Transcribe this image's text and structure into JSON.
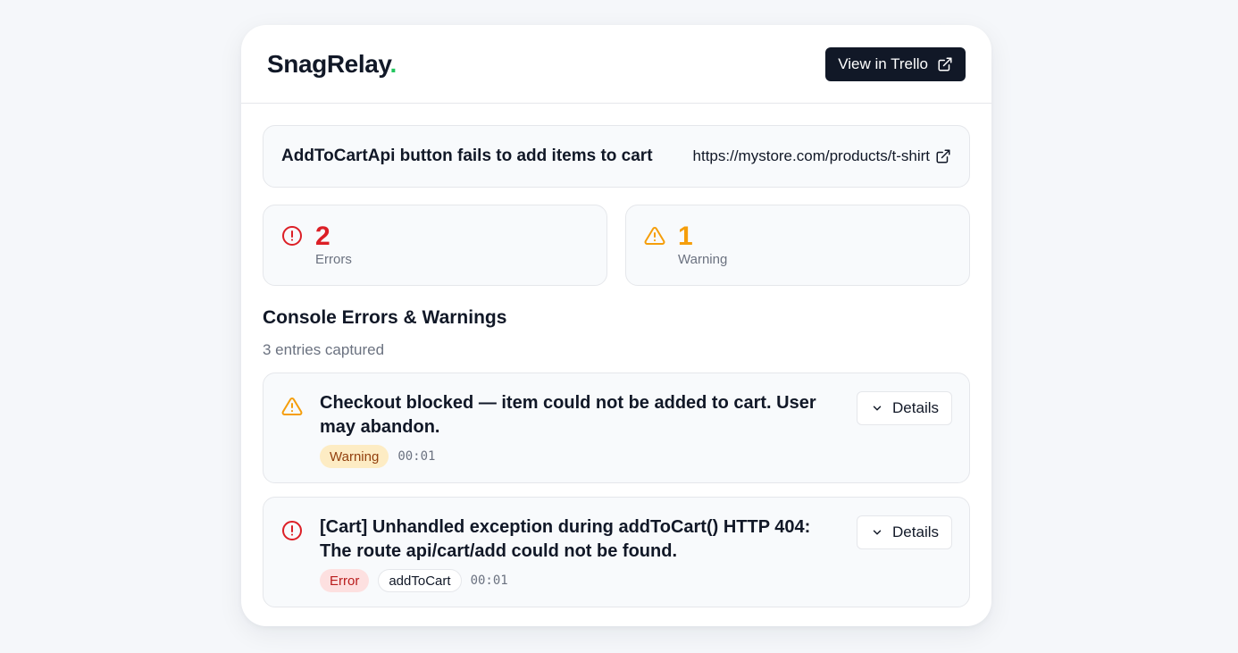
{
  "header": {
    "logo_text": "SnagRelay",
    "logo_dot": ".",
    "view_button_label": "View in Trello"
  },
  "report": {
    "title": "AddToCartApi button fails to add items to cart",
    "url": "https://mystore.com/products/t-shirt"
  },
  "stats": {
    "errors": {
      "count": "2",
      "label": "Errors"
    },
    "warnings": {
      "count": "1",
      "label": "Warning"
    }
  },
  "console": {
    "title": "Console Errors & Warnings",
    "subtitle": "3 entries captured",
    "entries": [
      {
        "type": "warning",
        "message": "Checkout blocked — item could not be added to cart. User may abandon.",
        "badge": "Warning",
        "time": "00:01",
        "details_label": "Details"
      },
      {
        "type": "error",
        "message": "[Cart] Unhandled exception during addToCart() HTTP 404: The route api/cart/add could not be found.",
        "badge": "Error",
        "tag": "addToCart",
        "time": "00:01",
        "details_label": "Details"
      }
    ]
  },
  "colors": {
    "error": "#dc1f26",
    "warning": "#f59e0b",
    "brand_dot": "#22c55e",
    "dark_button": "#111827"
  },
  "icons": {
    "external": "external-link-icon",
    "error": "error-circle-icon",
    "warning": "warning-triangle-icon",
    "chevron": "chevron-down-icon"
  }
}
